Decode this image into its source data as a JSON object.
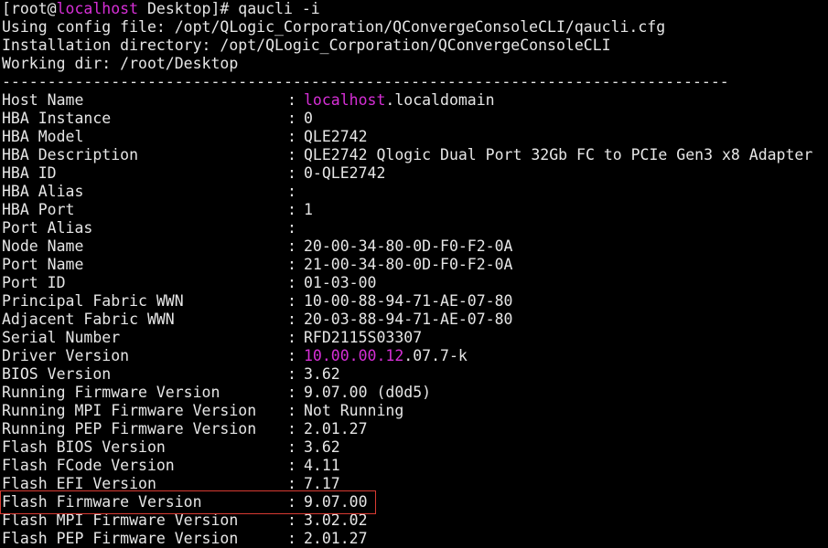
{
  "prompt": {
    "open_bracket": "[",
    "user": "root@",
    "host": "localhost",
    "dir": " Desktop]# ",
    "command": "qaucli -i"
  },
  "info_lines": [
    "Using config file: /opt/QLogic_Corporation/QConvergeConsoleCLI/qaucli.cfg",
    "Installation directory: /opt/QLogic_Corporation/QConvergeConsoleCLI",
    "Working dir: /root/Desktop"
  ],
  "divider": "--------------------------------------------------------------------------------",
  "separator": ":",
  "fields": {
    "host_name": {
      "key": "Host Name",
      "value_highlight": "localhost",
      "value": ".localdomain"
    },
    "hba_instance": {
      "key": "HBA Instance",
      "value": "0"
    },
    "hba_model": {
      "key": "HBA Model",
      "value": "QLE2742"
    },
    "hba_description": {
      "key": "HBA Description",
      "value": "QLE2742 Qlogic Dual Port 32Gb FC to PCIe Gen3 x8 Adapter"
    },
    "hba_id": {
      "key": "HBA ID",
      "value": "0-QLE2742"
    },
    "hba_alias": {
      "key": "HBA Alias",
      "value": ""
    },
    "hba_port": {
      "key": "HBA Port",
      "value": "1"
    },
    "port_alias": {
      "key": "Port Alias",
      "value": ""
    },
    "node_name": {
      "key": "Node Name",
      "value": "20-00-34-80-0D-F0-F2-0A"
    },
    "port_name": {
      "key": "Port Name",
      "value": "21-00-34-80-0D-F0-F2-0A"
    },
    "port_id": {
      "key": "Port ID",
      "value": "01-03-00"
    },
    "principal_fabric_wwn": {
      "key": "Principal Fabric WWN",
      "value": "10-00-88-94-71-AE-07-80"
    },
    "adjacent_fabric_wwn": {
      "key": "Adjacent Fabric WWN",
      "value": "20-03-88-94-71-AE-07-80"
    },
    "serial_number": {
      "key": "Serial Number",
      "value": "RFD2115S03307"
    },
    "driver_version": {
      "key": "Driver Version",
      "value_highlight": "10.00.00.12",
      "value": ".07.7-k"
    },
    "bios_version": {
      "key": "BIOS Version",
      "value": "3.62"
    },
    "running_firmware_version": {
      "key": "Running Firmware Version",
      "value": "9.07.00 (d0d5)"
    },
    "running_mpi_firmware_version": {
      "key": "Running MPI Firmware Version",
      "value": "Not Running"
    },
    "running_pep_firmware_version": {
      "key": "Running PEP Firmware Version",
      "value": "2.01.27"
    },
    "flash_bios_version": {
      "key": "Flash BIOS Version",
      "value": "3.62"
    },
    "flash_fcode_version": {
      "key": "Flash FCode Version",
      "value": "4.11"
    },
    "flash_efi_version": {
      "key": "Flash EFI Version",
      "value": "7.17"
    },
    "flash_firmware_version": {
      "key": "Flash Firmware Version",
      "value": "9.07.00"
    },
    "flash_mpi_firmware_version": {
      "key": "Flash MPI Firmware Version",
      "value": "3.02.02"
    },
    "flash_pep_firmware_version": {
      "key": "Flash PEP Firmware Version",
      "value": "2.01.27"
    }
  },
  "colors": {
    "background": "#000000",
    "text": "#e6e6e6",
    "highlight_text": "#d62fd6",
    "annotation_box": "#d83a32"
  }
}
